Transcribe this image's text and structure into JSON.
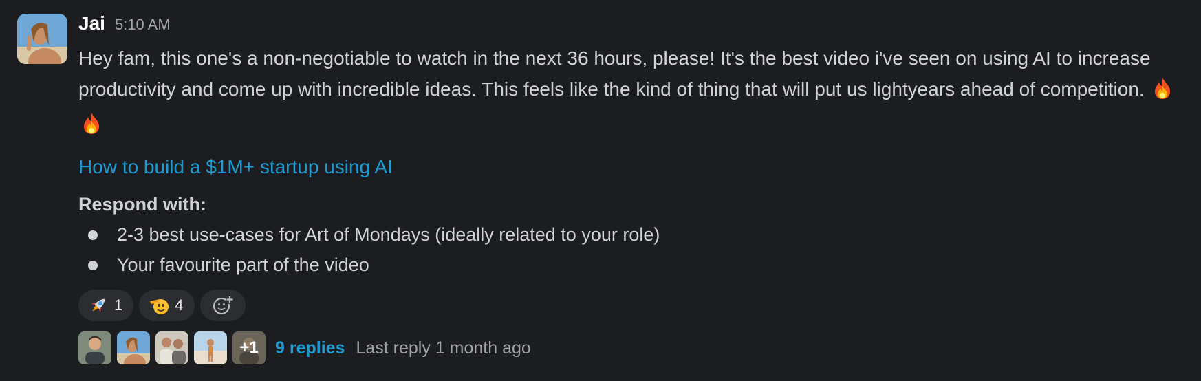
{
  "message": {
    "author": "Jai",
    "timestamp": "5:10 AM",
    "body": "Hey fam, this one's a non-negotiable to watch in the next 36 hours, please! It's the best video i've seen on using AI to increase productivity and come up with incredible ideas. This feels like the kind of thing that will put us lightyears ahead of competition.",
    "emojis": [
      "fire-icon",
      "fire-icon"
    ],
    "link_text": "How to build a $1M+ startup using AI",
    "respond_title": "Respond with:",
    "bullets": [
      "2-3 best use-cases for Art of Mondays (ideally related to your role)",
      "Your favourite part of the video"
    ]
  },
  "reactions": [
    {
      "icon": "rocket-icon",
      "count": "1"
    },
    {
      "icon": "saluting-face-icon",
      "count": "4"
    }
  ],
  "add_reaction_icon": "add-emoji-icon",
  "thread": {
    "avatars": [
      "avatar-1",
      "avatar-2",
      "avatar-3",
      "avatar-4"
    ],
    "more_label": "+1",
    "replies_label": "9 replies",
    "last_reply": "Last reply 1 month ago"
  },
  "colors": {
    "background": "#1b1d21",
    "text": "#d1d2d3",
    "link": "#1d9bd1",
    "muted": "#a1a2a5",
    "pill": "#2b2d31"
  }
}
